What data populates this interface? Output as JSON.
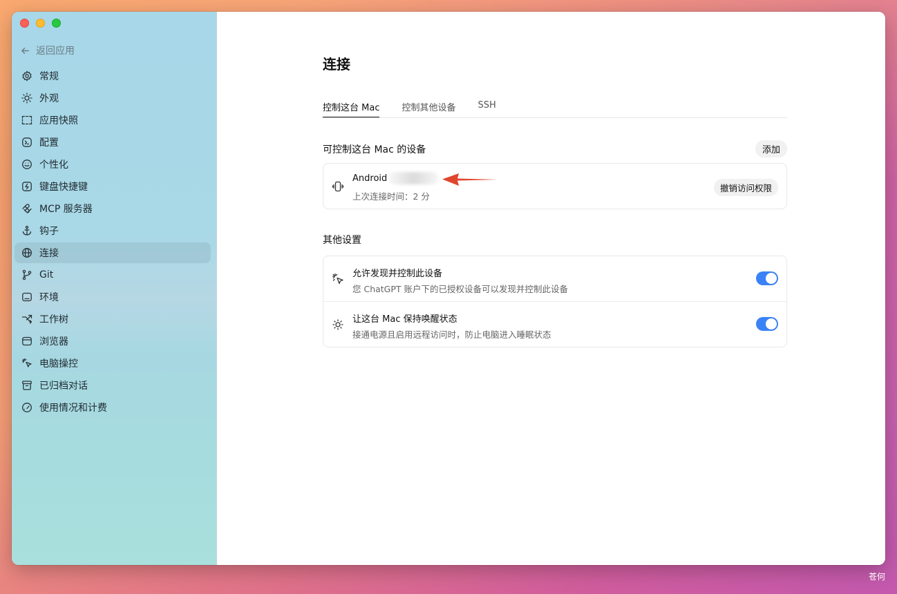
{
  "sidebar": {
    "back_label": "返回应用",
    "items": [
      {
        "label": "常规",
        "icon": "gear-icon"
      },
      {
        "label": "外观",
        "icon": "sun-icon"
      },
      {
        "label": "应用快照",
        "icon": "snapshot-frame-icon"
      },
      {
        "label": "配置",
        "icon": "config-icon"
      },
      {
        "label": "个性化",
        "icon": "smile-icon"
      },
      {
        "label": "键盘快捷键",
        "icon": "keyboard-shortcut-icon"
      },
      {
        "label": "MCP 服务器",
        "icon": "mcp-icon"
      },
      {
        "label": "钩子",
        "icon": "anchor-icon"
      },
      {
        "label": "连接",
        "icon": "globe-icon",
        "active": true
      },
      {
        "label": "Git",
        "icon": "git-branch-icon"
      },
      {
        "label": "环境",
        "icon": "laptop-icon"
      },
      {
        "label": "工作树",
        "icon": "worktree-icon"
      },
      {
        "label": "浏览器",
        "icon": "browser-window-icon"
      },
      {
        "label": "电脑操控",
        "icon": "cursor-click-icon"
      },
      {
        "label": "已归档对话",
        "icon": "archive-icon"
      },
      {
        "label": "使用情况和计费",
        "icon": "gauge-icon"
      }
    ]
  },
  "main": {
    "title": "连接",
    "tabs": [
      {
        "label": "控制这台 Mac",
        "active": true
      },
      {
        "label": "控制其他设备"
      },
      {
        "label": "SSH"
      }
    ],
    "devices_section": {
      "title": "可控制这台 Mac 的设备",
      "add_label": "添加",
      "device": {
        "name": "Android",
        "last_connected": "上次连接时间：2 分",
        "revoke_label": "撤销访问权限",
        "icon": "phone-vibrate-icon"
      }
    },
    "other_section": {
      "title": "其他设置",
      "rows": [
        {
          "title": "允许发现并控制此设备",
          "subtitle": "您 ChatGPT 账户下的已授权设备可以发现并控制此设备",
          "enabled": true,
          "icon": "cursor-click-icon"
        },
        {
          "title": "让这台 Mac 保持唤醒状态",
          "subtitle": "接通电源且启用远程访问时，防止电脑进入睡眠状态",
          "enabled": true,
          "icon": "sun-icon"
        }
      ]
    }
  },
  "watermark": "苍何",
  "colors": {
    "toggle_on": "#3b82f6",
    "arrow": "#e0452e",
    "sidebar_active": "#b9cdd6"
  }
}
